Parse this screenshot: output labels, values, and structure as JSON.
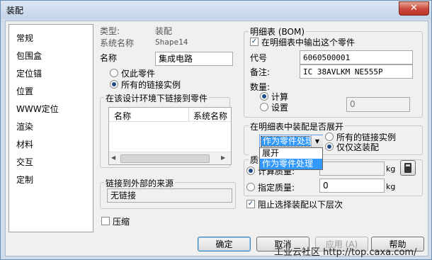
{
  "window": {
    "title": "装配",
    "close_glyph": "✕"
  },
  "nav": {
    "items": [
      "常规",
      "包围盒",
      "定位锚",
      "位置",
      "WWW定位",
      "渲染",
      "材料",
      "交互",
      "定制"
    ]
  },
  "info": {
    "type_label": "类型:",
    "type_value": "装配",
    "sysname_label": "系统名称",
    "sysname_value": "Shape14",
    "name_label": "名称",
    "name_value": "集成电路"
  },
  "scope": {
    "only_this": "仅此零件",
    "all_links": "所有的链接实例",
    "selected": "all_links"
  },
  "link_env": {
    "title": "在该设计环境下链接到零件",
    "columns": [
      "名称",
      "系统名称"
    ],
    "scroll_left": "◀",
    "scroll_right": "▶"
  },
  "ext_link": {
    "title": "链接到外部的来源",
    "value": "无链接"
  },
  "compress": {
    "label": "压缩",
    "checked": false
  },
  "bom": {
    "title": "明细表 (BOM)",
    "output_label": "在明细表中输出这个零件",
    "output_checked": true,
    "code_label": "代号",
    "code_value": "6060500001",
    "remark_label": "备注:",
    "remark_value": "IC 38AVLKM NE555P",
    "qty_label": "数量:",
    "calc_label": "计算",
    "set_label": "设置",
    "qty_value": "0",
    "qty_selected": "calc"
  },
  "expand": {
    "title": "在明细表中装配是否展开",
    "combo_value": "作为零件处理",
    "combo_arrow": "▼",
    "options": [
      "展开",
      "作为零件处理"
    ],
    "all_links": "所有的链接实例",
    "only_this": "仅仅这装配",
    "selected": "only_this"
  },
  "mass": {
    "title": "质",
    "calc_label": "计算质量:",
    "set_label": "指定质量:",
    "set_value": "0",
    "unit": "kg",
    "selected": "calc"
  },
  "block": {
    "label": "阻止选择装配以下层次",
    "checked": true
  },
  "buttons": {
    "ok": "确定",
    "cancel": "取消",
    "apply": "应用 (A)",
    "help": "帮助"
  },
  "watermark": "工业云社区 http://top.caxa.com/"
}
